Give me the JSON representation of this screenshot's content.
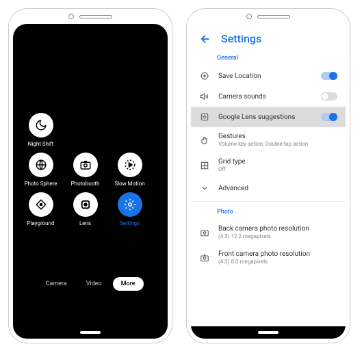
{
  "camera": {
    "modes": {
      "row1": [
        {
          "label": "Night Shift",
          "icon": "night"
        }
      ],
      "row2": [
        {
          "label": "Photo Sphere",
          "icon": "sphere"
        },
        {
          "label": "Photobooth",
          "icon": "booth"
        },
        {
          "label": "Slow Motion",
          "icon": "slowmo"
        }
      ],
      "row3": [
        {
          "label": "Playground",
          "icon": "playground"
        },
        {
          "label": "Lens",
          "icon": "lens"
        },
        {
          "label": "Settings",
          "icon": "settings",
          "selected": true
        }
      ]
    },
    "tabs": {
      "camera": "Camera",
      "video": "Video",
      "more": "More"
    }
  },
  "settings": {
    "title": "Settings",
    "sections": {
      "general": "General",
      "photo": "Photo"
    },
    "items": {
      "saveLocation": {
        "label": "Save Location"
      },
      "cameraSounds": {
        "label": "Camera sounds"
      },
      "lensSuggestions": {
        "label": "Google Lens suggestions"
      },
      "gestures": {
        "label": "Gestures",
        "sub": "Volume key action, Double-tap action"
      },
      "gridType": {
        "label": "Grid type",
        "sub": "Off"
      },
      "advanced": {
        "label": "Advanced"
      },
      "backRes": {
        "label": "Back camera photo resolution",
        "sub": "(4:3) 12.2 megapixels"
      },
      "frontRes": {
        "label": "Front camera photo resolution",
        "sub": "(4:3) 8.0 megapixels"
      }
    }
  }
}
